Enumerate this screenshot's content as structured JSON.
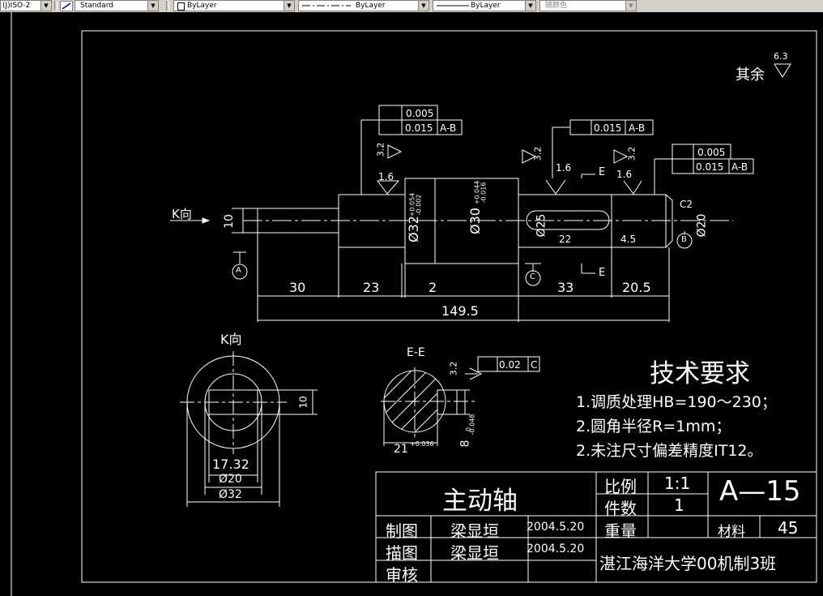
{
  "toolbar": {
    "textstyle": "(J)ISO-2",
    "dimstyle": "Standard",
    "layer": "ByLayer",
    "linetype": "ByLayer",
    "lineweight": "ByLayer",
    "color": "随颜色"
  },
  "drawing": {
    "roughness_note": "其余",
    "roughness_default": "6.3",
    "view_k_arrow": "K向",
    "view_k_title": "K向",
    "section_title": "E-E",
    "section_e_label": "E",
    "datum_a": "A",
    "datum_b": "B",
    "datum_c": "C",
    "tol_runout_1": "0.005",
    "tol_runout_1b": "0.015",
    "tol_ref_ab": "A-B",
    "tol_mid": "0.015",
    "tol_right_1": "0.005",
    "tol_right_2": "0.015",
    "tol_sym": "0.02",
    "tol_sym_ref": "C",
    "rough_32": "3.2",
    "rough_16": "1.6",
    "dim_10": "10",
    "dim_30": "30",
    "dim_23": "23",
    "dim_2": "2",
    "dim_33": "33",
    "dim_205": "20.5",
    "dim_1495": "149.5",
    "dim_22": "22",
    "dim_45": "4.5",
    "dim_d32": "Ø32",
    "dim_d32_tol_up": "+0.054",
    "dim_d32_tol_dn": "-0.002",
    "dim_d30": "Ø30",
    "dim_d30_tol_up": "+0.044",
    "dim_d30_tol_dn": "-0.016",
    "dim_d25": "Ø25",
    "dim_d20": "Ø20",
    "dim_c2": "C2",
    "k_dim_1732": "17.32",
    "k_dim_d20": "Ø20",
    "k_dim_d32": "Ø32",
    "k_dim_10": "10",
    "e_dim_21": "21",
    "e_dim_21_tol": "+0.036",
    "e_dim_8": "8",
    "e_dim_8_tol_up": "0",
    "e_dim_8_tol_dn": "-0.048"
  },
  "tech_req": {
    "title": "技术要求",
    "items": [
      "1.调质处理HB=190～230；",
      "2.圆角半径R=1mm；",
      "2.未注尺寸偏差精度IT12。"
    ]
  },
  "title_block": {
    "part_name": "主动轴",
    "scale_label": "比例",
    "scale_value": "1:1",
    "qty_label": "件数",
    "qty_value": "1",
    "drawing_no": "A—15",
    "drawn_label": "制图",
    "drawn_name": "梁显垣",
    "drawn_date": "2004.5.20",
    "traced_label": "描图",
    "traced_name": "梁显垣",
    "traced_date": "2004.5.20",
    "check_label": "审核",
    "weight_label": "重量",
    "material_label": "材料",
    "material_value": "45",
    "school": "湛江海洋大学00机制3班"
  }
}
